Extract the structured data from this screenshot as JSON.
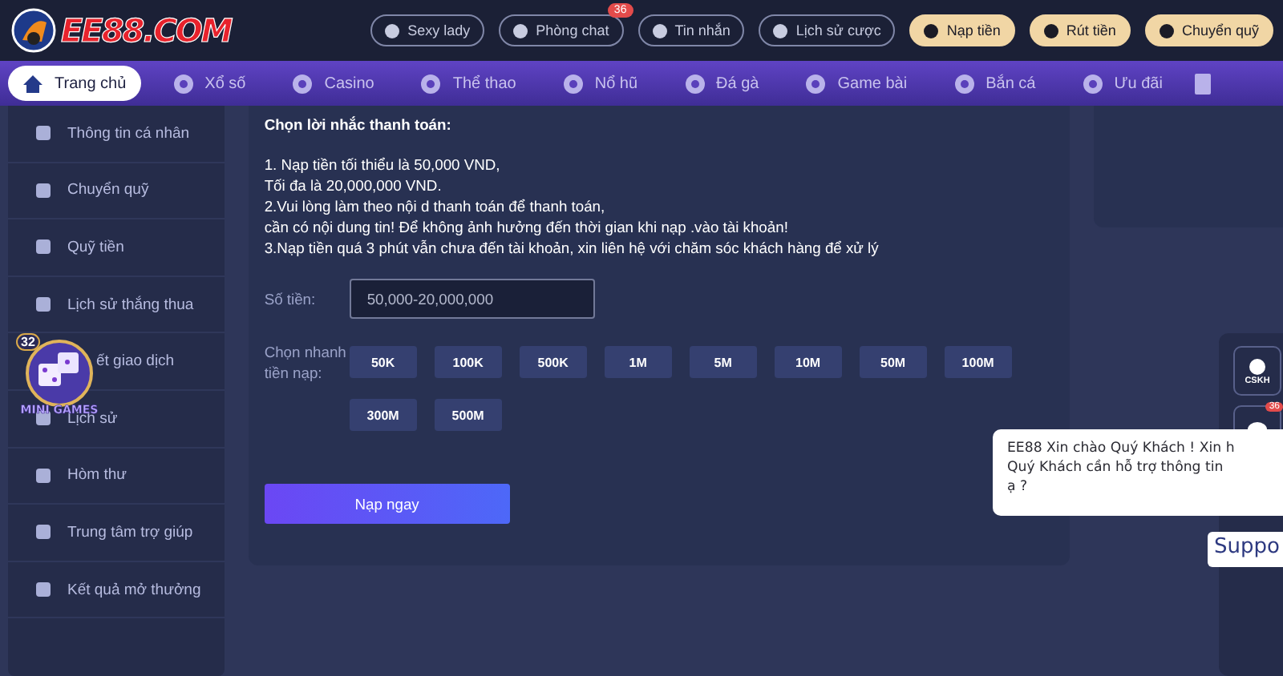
{
  "logo": {
    "text": "EE88.COM"
  },
  "header_links": [
    {
      "label": "Sexy lady",
      "kind": "outline"
    },
    {
      "label": "Phòng chat",
      "kind": "outline",
      "badge": "36"
    },
    {
      "label": "Tin nhắn",
      "kind": "outline"
    },
    {
      "label": "Lịch sử cược",
      "kind": "outline"
    },
    {
      "label": "Nạp tiền",
      "kind": "gold"
    },
    {
      "label": "Rút tiền",
      "kind": "gold"
    },
    {
      "label": "Chuyển quỹ",
      "kind": "gold"
    }
  ],
  "nav": [
    {
      "label": "Trang chủ",
      "selected": true
    },
    {
      "label": "Xổ số",
      "selected": false
    },
    {
      "label": "Casino",
      "selected": false
    },
    {
      "label": "Thể thao",
      "selected": false
    },
    {
      "label": "Nổ hũ",
      "selected": false
    },
    {
      "label": "Đá gà",
      "selected": false
    },
    {
      "label": "Game bài",
      "selected": false
    },
    {
      "label": "Bắn cá",
      "selected": false
    },
    {
      "label": "Ưu đãi",
      "selected": false
    }
  ],
  "sidebar": {
    "items": [
      {
        "label": "Thông tin cá nhân"
      },
      {
        "label": "Chuyển quỹ"
      },
      {
        "label": "Quỹ tiền"
      },
      {
        "label": "Lịch sử thắng thua"
      },
      {
        "label": "ết giao dịch"
      },
      {
        "label": "Lịch sử"
      },
      {
        "label": "Hòm thư"
      },
      {
        "label": "Trung tâm trợ giúp"
      },
      {
        "label": "Kết quả mở thưởng"
      }
    ]
  },
  "mini_games": {
    "badge": "32",
    "label": "MINI GAMES"
  },
  "deposit": {
    "title": "Chọn lời nhắc thanh toán:",
    "notes": [
      "1. Nạp tiền tối thiểu là 50,000 VND,",
      "Tối đa là 20,000,000 VND.",
      "2.Vui lòng làm theo nội d thanh toán để thanh toán,",
      "cần có nội dung tin! Để không ảnh hưởng đến thời gian khi nạp .vào tài khoản!",
      "3.Nạp tiền quá 3 phút vẫn chưa đến tài khoản, xin liên hệ với chăm sóc khách hàng để xử lý"
    ],
    "amount": {
      "label": "Số tiền:",
      "placeholder": "50,000-20,000,000"
    },
    "quick": {
      "label": "Chọn nhanh tiền nạp:",
      "options": [
        "50K",
        "100K",
        "500K",
        "1M",
        "5M",
        "10M",
        "50M",
        "100M",
        "300M",
        "500M"
      ]
    },
    "submit": "Nạp ngay"
  },
  "support": {
    "tools": [
      {
        "label": "CSKH"
      },
      {
        "badge": "36"
      }
    ],
    "greeting": [
      "EE88 Xin chào Quý Khách ! Xin h",
      "Quý Khách cần hỗ trợ thông tin",
      "ạ ?"
    ],
    "tooltip": "Suppo"
  }
}
